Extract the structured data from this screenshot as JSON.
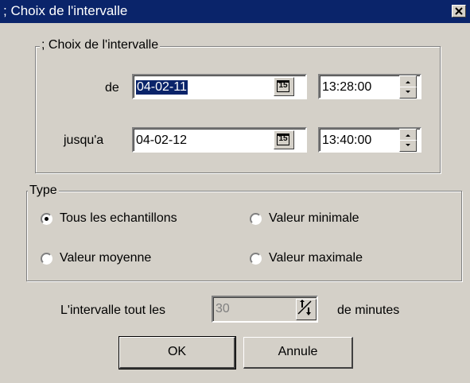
{
  "window": {
    "title": "; Choix de l'intervalle"
  },
  "interval_group": {
    "legend": "; Choix de l'intervalle",
    "from": {
      "label": "de",
      "date": "04-02-11",
      "time": "13:28:00",
      "calendar_icon_text": "15"
    },
    "to": {
      "label": "jusqu'a",
      "date": "04-02-12",
      "time": "13:40:00",
      "calendar_icon_text": "15"
    }
  },
  "type_group": {
    "legend": "Type",
    "options": [
      {
        "label": "Tous les echantillons",
        "selected": true
      },
      {
        "label": "Valeur minimale",
        "selected": false
      },
      {
        "label": "Valeur moyenne",
        "selected": false
      },
      {
        "label": "Valeur maximale",
        "selected": false
      }
    ]
  },
  "interval_every": {
    "label": "L'intervalle tout les",
    "value": "30",
    "suffix": "de minutes"
  },
  "buttons": {
    "ok": "OK",
    "cancel": "Annule"
  }
}
